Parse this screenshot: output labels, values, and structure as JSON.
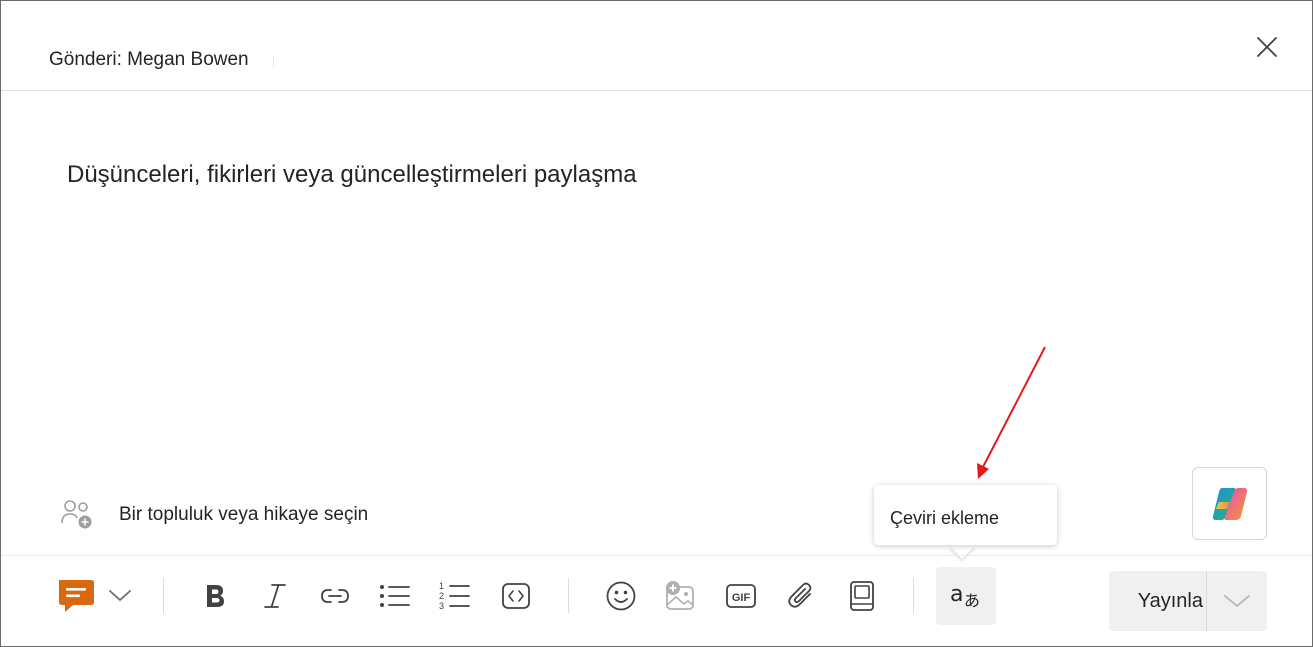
{
  "header": {
    "title": "Gönderi: Megan Bowen",
    "close_icon": "close-icon"
  },
  "editor": {
    "placeholder": "Düşünceleri, fikirleri veya güncelleştirmeleri paylaşma"
  },
  "community": {
    "label": "Bir topluluk veya hikaye seçin",
    "icon": "people-add-icon"
  },
  "copilot": {
    "icon": "copilot-icon"
  },
  "tooltip": {
    "text": "Çeviri ekleme"
  },
  "toolbar": {
    "post_type_icon": "discussion-icon",
    "post_type_color": "#d9690f",
    "items": [
      {
        "name": "bold",
        "icon": "bold-icon"
      },
      {
        "name": "italic",
        "icon": "italic-icon"
      },
      {
        "name": "link",
        "icon": "link-icon"
      },
      {
        "name": "bulleted-list",
        "icon": "bulleted-list-icon"
      },
      {
        "name": "numbered-list",
        "icon": "numbered-list-icon"
      },
      {
        "name": "code",
        "icon": "code-icon"
      },
      {
        "name": "emoji",
        "icon": "emoji-icon"
      },
      {
        "name": "image",
        "icon": "image-add-icon"
      },
      {
        "name": "gif",
        "icon": "gif-icon"
      },
      {
        "name": "attach",
        "icon": "attach-icon"
      },
      {
        "name": "book",
        "icon": "book-icon"
      },
      {
        "name": "translate",
        "icon": "translate-icon"
      }
    ]
  },
  "publish": {
    "label": "Yayınla"
  },
  "annotation": {
    "arrow_color": "#e01b1b"
  }
}
